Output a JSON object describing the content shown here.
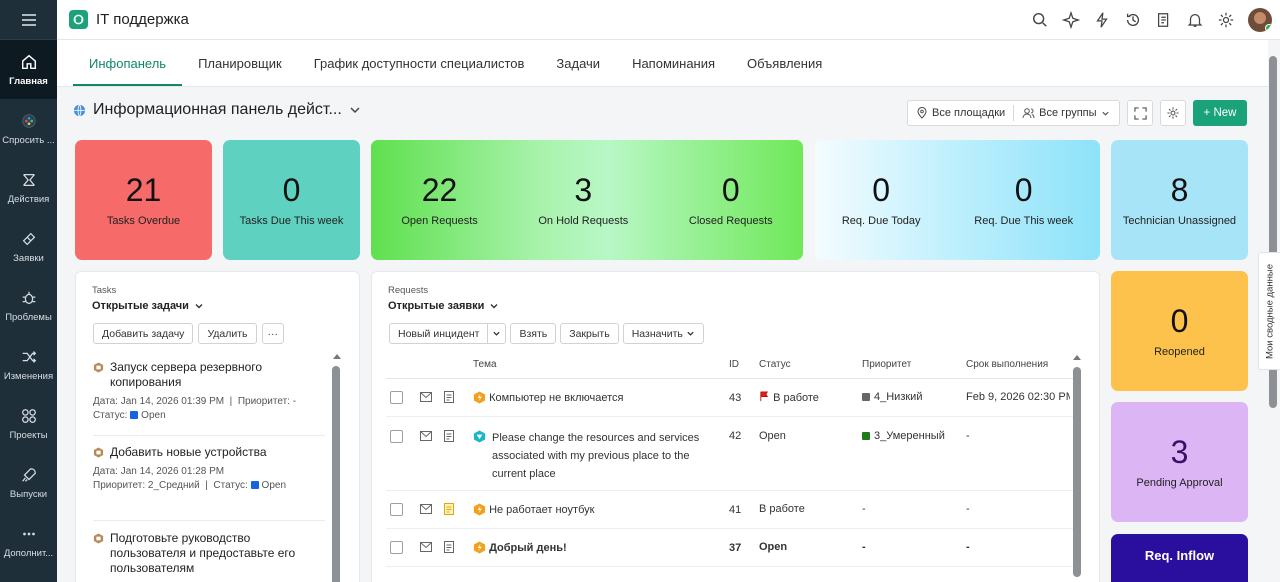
{
  "app": {
    "title": "IT поддержка"
  },
  "sidebar": {
    "items": [
      {
        "label": "Главная",
        "icon": "home-icon"
      },
      {
        "label": "Спросить ...",
        "icon": "zia-icon"
      },
      {
        "label": "Действия",
        "icon": "actions-icon"
      },
      {
        "label": "Заявки",
        "icon": "requests-icon"
      },
      {
        "label": "Проблемы",
        "icon": "problems-icon"
      },
      {
        "label": "Изменения",
        "icon": "changes-icon"
      },
      {
        "label": "Проекты",
        "icon": "projects-icon"
      },
      {
        "label": "Выпуски",
        "icon": "releases-icon"
      },
      {
        "label": "Дополнит...",
        "icon": "more-icon"
      }
    ]
  },
  "tabs": [
    "Инфопанель",
    "Планировщик",
    "График доступности специалистов",
    "Задачи",
    "Напоминания",
    "Объявления"
  ],
  "dashboard": {
    "title": "Информационная панель дейст...",
    "site_filter": "Все площадки",
    "group_filter": "Все группы",
    "new_label": "+ New"
  },
  "cards": {
    "tasks_overdue": {
      "value": "21",
      "label": "Tasks Overdue"
    },
    "tasks_due_week": {
      "value": "0",
      "label": "Tasks Due This week"
    },
    "open_requests": {
      "value": "22",
      "label": "Open Requests"
    },
    "on_hold": {
      "value": "3",
      "label": "On Hold Requests"
    },
    "closed": {
      "value": "0",
      "label": "Closed Requests"
    },
    "due_today": {
      "value": "0",
      "label": "Req. Due Today"
    },
    "due_week": {
      "value": "0",
      "label": "Req. Due This week"
    },
    "unassigned": {
      "value": "8",
      "label": "Technician Unassigned"
    },
    "reopened": {
      "value": "0",
      "label": "Reopened"
    },
    "pending": {
      "value": "3",
      "label": "Pending Approval"
    },
    "inflow": {
      "label": "Req. Inflow"
    }
  },
  "colors": {
    "accent": "#1aa37a",
    "overdue": "#f66a6a",
    "teal": "#5fd1c0",
    "reopened": "#fcc24c",
    "pending": "#dcb5f4",
    "inflow": "#2a0f9e"
  },
  "tasks_panel": {
    "tag": "Tasks",
    "selector": "Открытые задачи",
    "add_btn": "Добавить задачу",
    "delete_btn": "Удалить",
    "more_btn": "···",
    "items": [
      {
        "title": "Запуск сервера резервного копирования",
        "date": "Дата: Jan 14, 2026 01:39 PM",
        "priority": "Приоритет: -",
        "status": "Статус:",
        "status_val": "Open"
      },
      {
        "title": "Добавить новые устройства",
        "date": "Дата: Jan 14, 2026 01:28 PM",
        "priority": "Приоритет: 2_Средний",
        "status": "Статус:",
        "status_val": "Open"
      },
      {
        "title": "Подготовьте руководство пользователя и предоставьте его пользователям"
      }
    ]
  },
  "requests_panel": {
    "tag": "Requests",
    "selector": "Открытые заявки",
    "new_incident": "Новый инцидент",
    "take": "Взять",
    "close": "Закрыть",
    "assign": "Назначить",
    "columns": [
      "Тема",
      "ID",
      "Статус",
      "Приоритет",
      "Срок выполнения"
    ],
    "rows": [
      {
        "subject": "Компьютер не включается",
        "id": "43",
        "status": "В работе",
        "priority": "4_Низкий",
        "due": "Feb 9, 2026 02:30 PM"
      },
      {
        "subject": "Please change the resources and services associated with my previous place to the current place",
        "id": "42",
        "status": "Open",
        "priority": "3_Умеренный",
        "due": "-"
      },
      {
        "subject": "Не работает ноутбук",
        "id": "41",
        "status": "В работе",
        "priority": "-",
        "due": "-"
      },
      {
        "subject": "Добрый день!",
        "id": "37",
        "status": "Open",
        "priority": "-",
        "due": "-"
      }
    ]
  },
  "side_tab": {
    "label": "Мои сводные данные"
  }
}
